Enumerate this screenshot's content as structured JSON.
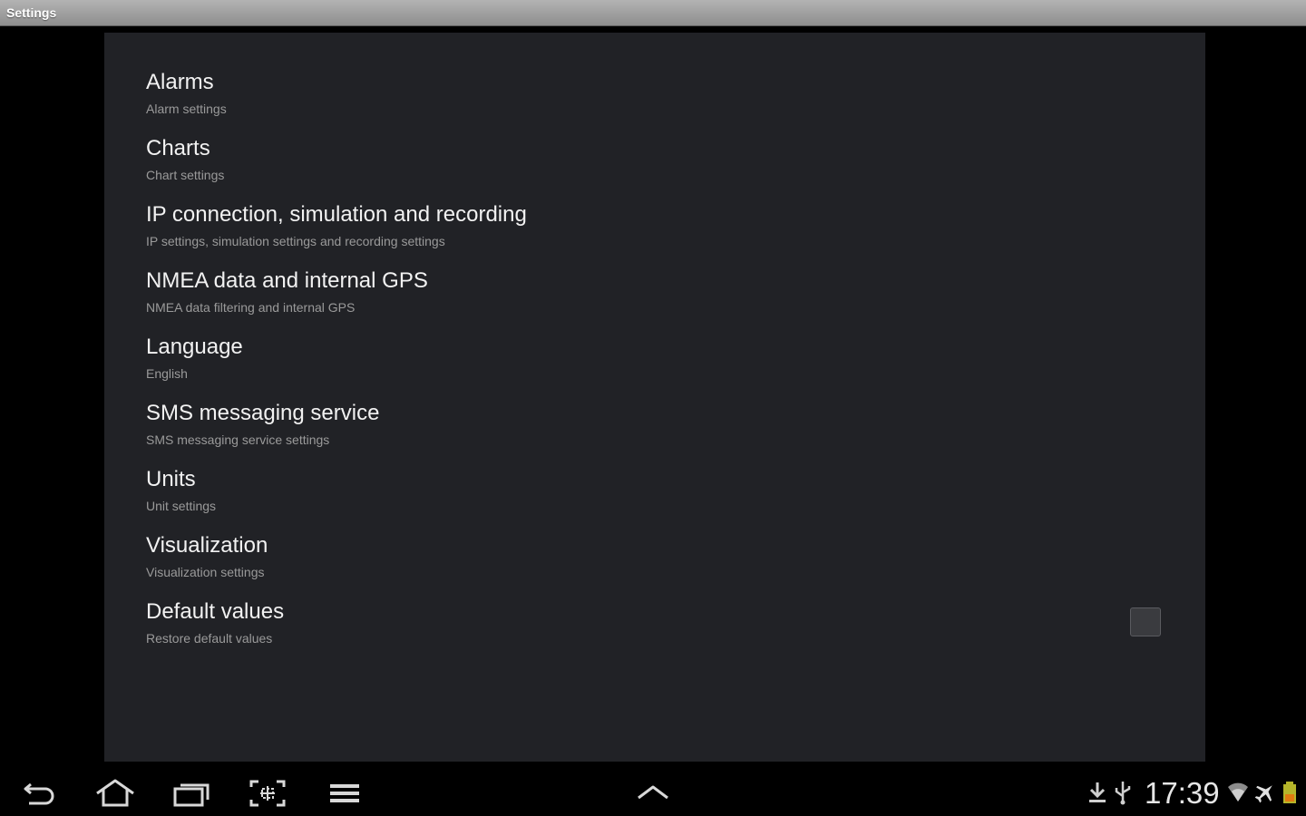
{
  "window": {
    "title": "Settings"
  },
  "settings": [
    {
      "title": "Alarms",
      "summary": "Alarm settings"
    },
    {
      "title": "Charts",
      "summary": "Chart settings"
    },
    {
      "title": "IP connection, simulation and recording",
      "summary": "IP settings, simulation settings and recording settings"
    },
    {
      "title": "NMEA data and internal GPS",
      "summary": "NMEA data filtering and internal GPS"
    },
    {
      "title": "Language",
      "summary": "English"
    },
    {
      "title": "SMS messaging service",
      "summary": "SMS messaging service settings"
    },
    {
      "title": "Units",
      "summary": "Unit settings"
    },
    {
      "title": "Visualization",
      "summary": "Visualization settings"
    },
    {
      "title": "Default values",
      "summary": "Restore default values",
      "checkbox_checked": false
    }
  ],
  "navbar": {
    "buttons": [
      "back-icon",
      "home-icon",
      "recent-apps-icon",
      "screenshot-icon",
      "menu-icon",
      "chevron-up-icon"
    ]
  },
  "status_bar": {
    "time": "17:39",
    "icons": [
      "download-icon",
      "usb-icon",
      "wifi-icon",
      "airplane-mode-icon",
      "battery-icon"
    ]
  },
  "colors": {
    "panel_bg": "#212226",
    "title_text": "#f2f2f2",
    "summary_text": "#9a9a9a",
    "screen_bg": "#000000"
  }
}
